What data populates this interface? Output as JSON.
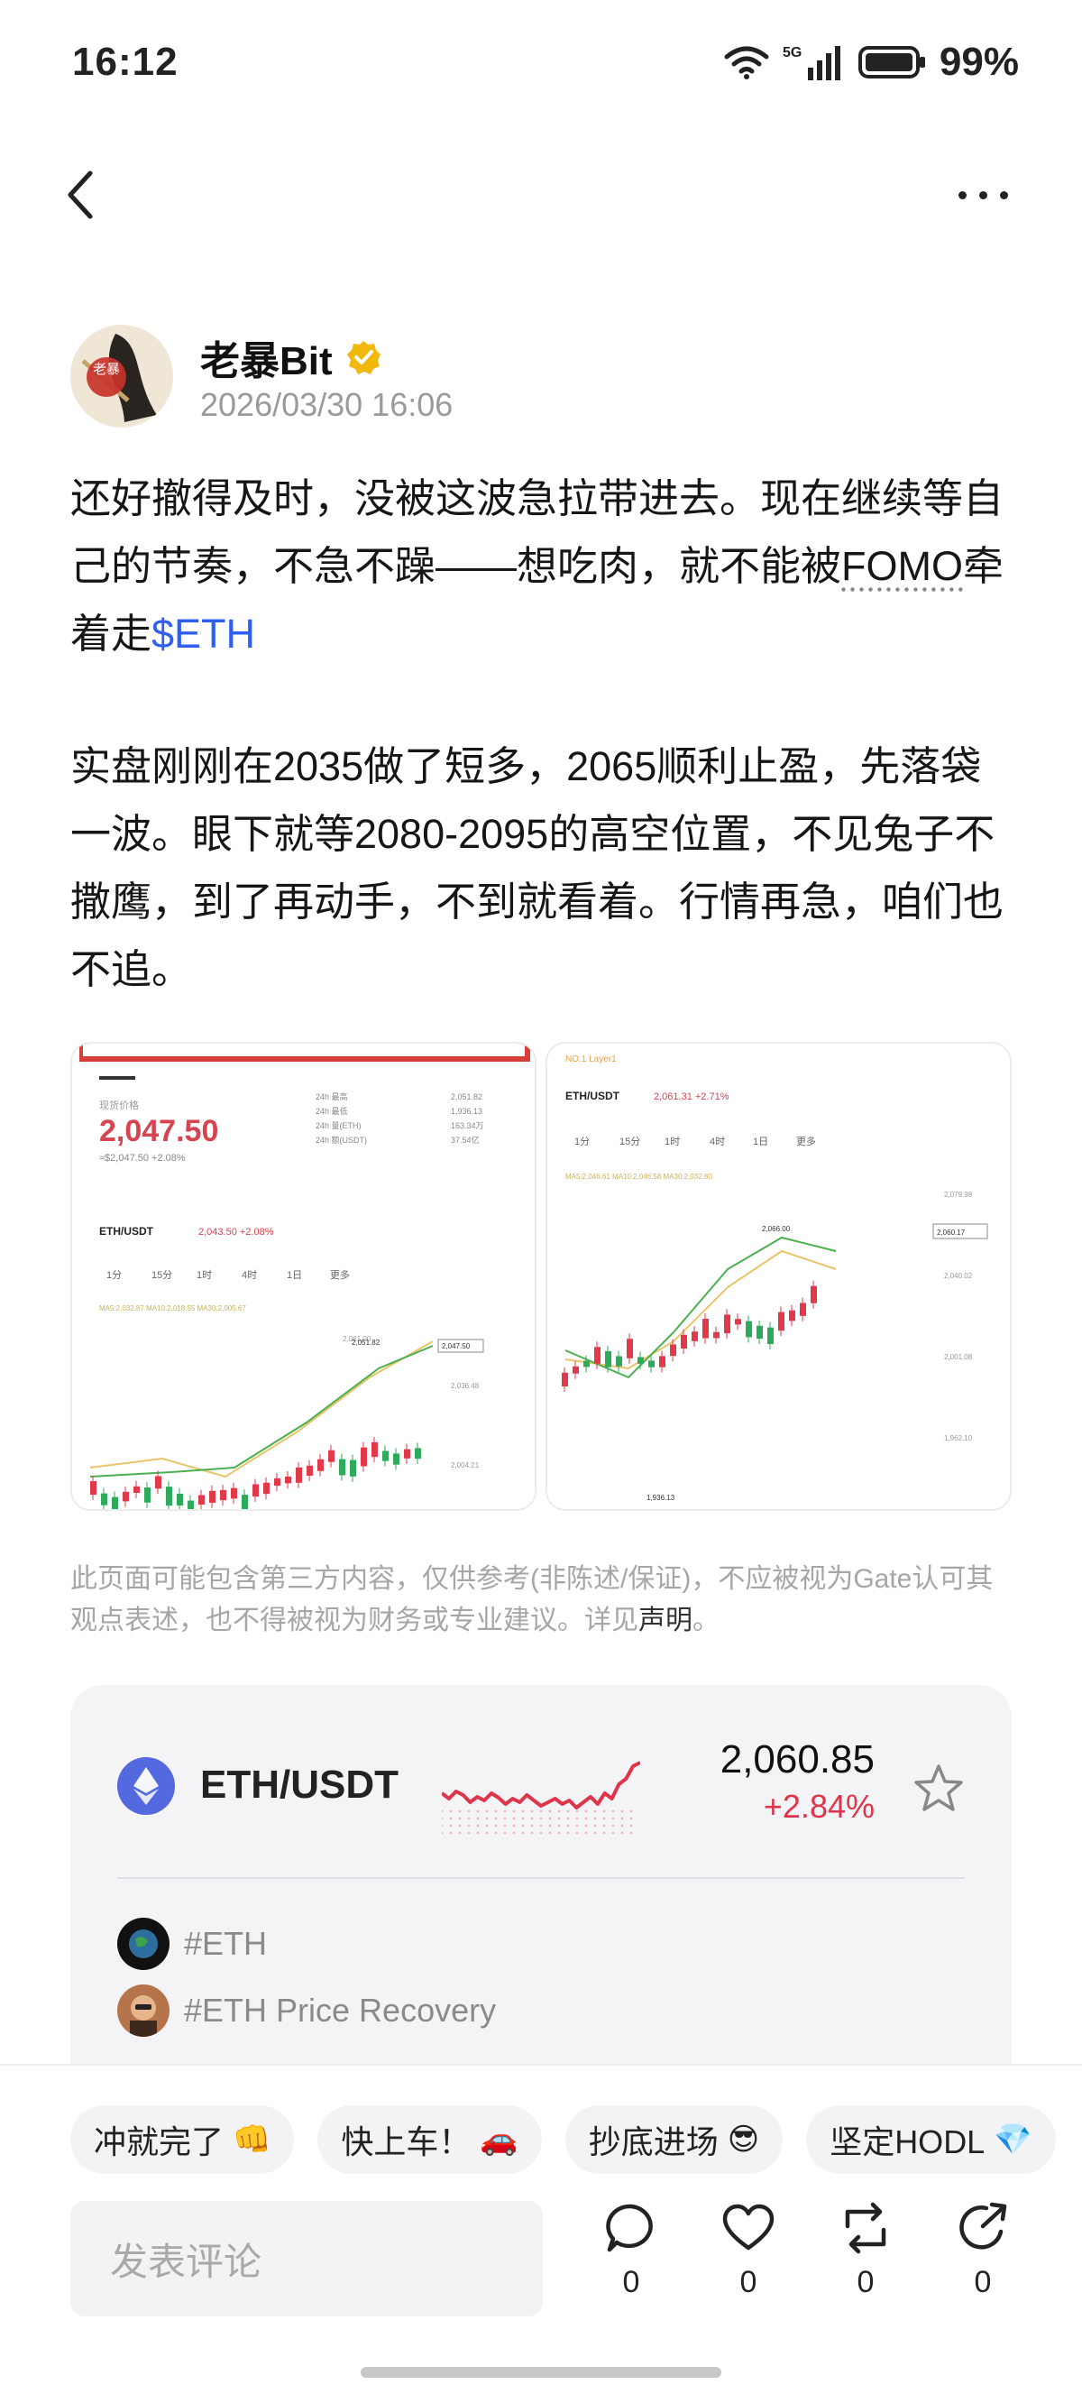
{
  "status": {
    "time": "16:12",
    "network": "5G",
    "battery": "99%"
  },
  "nav": {
    "back_icon": "chevron-left-icon",
    "more_icon": "more-dots-icon"
  },
  "author": {
    "name": "老暴Bit",
    "date": "2026/03/30 16:06",
    "verified_color": "#f0b90b",
    "avatar_text": "老暴"
  },
  "post": {
    "para1_text": "还好撤得及时，没被这波急拉带进去。现在继续等自己的节奏，不急不躁——想吃肉，就不能被",
    "para1_fomo": "FOMO",
    "para1_after": "牵着走",
    "para1_tag": "$ETH",
    "para2": "实盘刚刚在2035做了短多，2065顺利止盈，先落袋一波。眼下就等2080-2095的高空位置，不见兔子不撒鹰，到了再动手，不到就看着。行情再急，咱们也不追。"
  },
  "images": {
    "a": {
      "label": "现货价格",
      "price": "2,047.50",
      "sub": "≈$2,047.50  +2.08%",
      "pair": "ETH/USDT",
      "pair_price": "2,043.50  +2.08%",
      "tabs": [
        "1分",
        "15分",
        "1时",
        "4时",
        "1日",
        "更多"
      ],
      "stats": [
        [
          "24h 最高",
          "2,051.82"
        ],
        [
          "24h 最低",
          "1,936.13"
        ],
        [
          "24h 量(ETH)",
          "163.34万"
        ],
        [
          "24h 额(USDT)",
          "37.54亿"
        ]
      ],
      "ma": "MA5:2,032.87  MA10:2,018.55  MA30:2,005.67",
      "high_label": "2,051.82",
      "last_label": "2,047.50",
      "axis": [
        "2,061.00",
        "2,036.48",
        "2,004.21"
      ]
    },
    "b": {
      "crumb": "NO.1   Layer1",
      "pair": "ETH/USDT",
      "pair_price": "2,061.31  +2.71%",
      "tabs": [
        "1分",
        "15分",
        "1时",
        "4时",
        "1日",
        "更多"
      ],
      "ma": "MA5:2,046.61  MA10:2,046.58  MA30:2,032.80",
      "high_label": "2,066.00",
      "last_label": "2,060.17",
      "low_label": "1,936.13",
      "axis": [
        "2,079.98",
        "2,040.02",
        "2,001.08",
        "1,962.10"
      ]
    }
  },
  "disclaimer": {
    "text": "此页面可能包含第三方内容，仅供参考(非陈述/保证)，不应被视为Gate认可其观点表述，也不得被视为财务或专业建议。详见",
    "link": "声明",
    "end": "。"
  },
  "market": {
    "pair": "ETH/USDT",
    "price": "2,060.85",
    "change": "+2.84%",
    "change_color": "#e0344a",
    "coin_icon": "ethereum-icon",
    "topics": [
      "#ETH",
      "#ETH Price Recovery"
    ]
  },
  "chips": [
    {
      "label": "冲就完了",
      "emoji": "👊"
    },
    {
      "label": "快上车！",
      "emoji": "🚗"
    },
    {
      "label": "抄底进场",
      "emoji": "😎"
    },
    {
      "label": "坚定HODL",
      "emoji": "💎"
    }
  ],
  "comment": {
    "placeholder": "发表评论"
  },
  "actions": {
    "comment_count": "0",
    "like_count": "0",
    "repost_count": "0",
    "share_count": "0"
  }
}
